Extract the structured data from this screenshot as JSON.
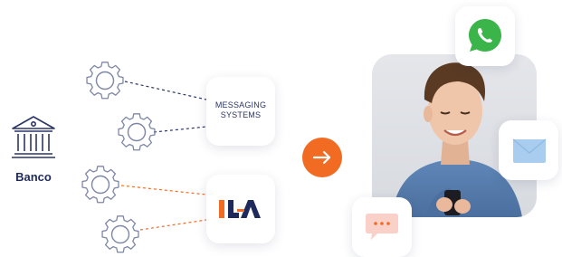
{
  "bank": {
    "label": "Banco",
    "icon": "bank-building-icon"
  },
  "gears": [
    "gear-icon",
    "gear-icon",
    "gear-icon",
    "gear-icon"
  ],
  "messaging_card": {
    "line1": "MESSAGING",
    "line2": "SYSTEMS"
  },
  "ila_card": {
    "logo_text": "ILA",
    "colors": {
      "orange": "#f26b22",
      "navy": "#1f2a5c"
    }
  },
  "arrow_button": {
    "icon": "arrow-right-icon",
    "color": "#f26b22"
  },
  "channels": [
    "whatsapp-icon",
    "email-icon",
    "chat-bubble-icon"
  ],
  "colors": {
    "navy": "#2b3566",
    "orange": "#f26b22",
    "gear_stroke": "#7d86a6",
    "whatsapp_green": "#3bb54a",
    "email_blue": "#a9cdef",
    "chat_pink": "#f9d1c8"
  }
}
